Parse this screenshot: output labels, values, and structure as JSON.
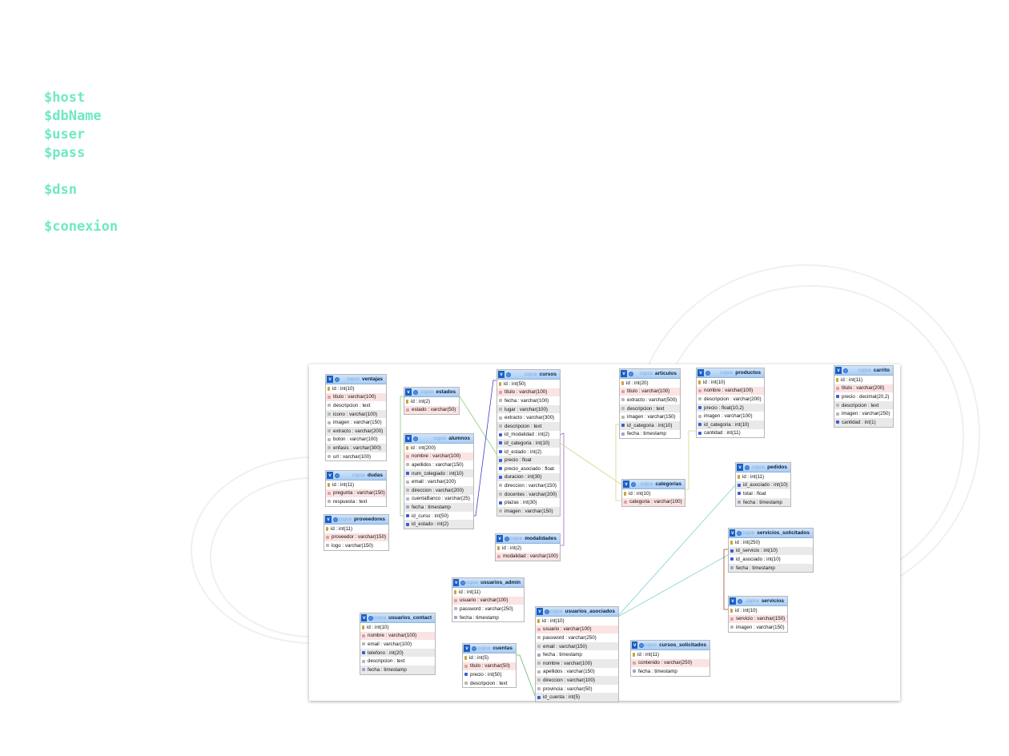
{
  "code_vars": [
    "$host",
    "$dbName",
    "$user",
    "$pass",
    "",
    "$dsn",
    "",
    "$conexion"
  ],
  "diagram": {
    "schema_label": "copce",
    "tables": [
      {
        "id": "ventajas",
        "name": "ventajas",
        "fields": [
          {
            "text": "id : int(10)",
            "icon": "k",
            "tone": "t1"
          },
          {
            "text": "titulo : varchar(100)",
            "icon": "r",
            "tone": "t2"
          },
          {
            "text": "descripcion : text",
            "icon": "s",
            "tone": "t1"
          },
          {
            "text": "icono : varchar(100)",
            "icon": "s",
            "tone": "t3"
          },
          {
            "text": "imagen : varchar(150)",
            "icon": "s",
            "tone": "t1"
          },
          {
            "text": "extracto : varchar(200)",
            "icon": "s",
            "tone": "t3"
          },
          {
            "text": "boton : varchar(100)",
            "icon": "s",
            "tone": "t1"
          },
          {
            "text": "enfasis : varchar(300)",
            "icon": "s",
            "tone": "t3"
          },
          {
            "text": "url : varchar(100)",
            "icon": "s",
            "tone": "t1"
          }
        ]
      },
      {
        "id": "dudas",
        "name": "dudas",
        "fields": [
          {
            "text": "id : int(11)",
            "icon": "k",
            "tone": "t1"
          },
          {
            "text": "pregunta : varchar(150)",
            "icon": "r",
            "tone": "t2"
          },
          {
            "text": "respuesta : text",
            "icon": "s",
            "tone": "t1"
          }
        ]
      },
      {
        "id": "proveedores",
        "name": "proveedores",
        "fields": [
          {
            "text": "id : int(11)",
            "icon": "k",
            "tone": "t1"
          },
          {
            "text": "proveedor : varchar(150)",
            "icon": "r",
            "tone": "t2"
          },
          {
            "text": "logo : varchar(150)",
            "icon": "s",
            "tone": "t1"
          }
        ]
      },
      {
        "id": "estados",
        "name": "estados",
        "fields": [
          {
            "text": "id : int(2)",
            "icon": "k",
            "tone": "t1"
          },
          {
            "text": "estado : varchar(50)",
            "icon": "r",
            "tone": "t2"
          }
        ]
      },
      {
        "id": "alumnos",
        "name": "alumnos",
        "fields": [
          {
            "text": "id : int(200)",
            "icon": "k",
            "tone": "t1"
          },
          {
            "text": "nombre : varchar(100)",
            "icon": "r",
            "tone": "t2"
          },
          {
            "text": "apellidos : varchar(150)",
            "icon": "s",
            "tone": "t1"
          },
          {
            "text": "num_colegiado : int(10)",
            "icon": "b",
            "tone": "t3"
          },
          {
            "text": "email : varchar(100)",
            "icon": "s",
            "tone": "t1"
          },
          {
            "text": "direccion : varchar(200)",
            "icon": "s",
            "tone": "t3"
          },
          {
            "text": "cuentaBanco : varchar(25)",
            "icon": "s",
            "tone": "t1"
          },
          {
            "text": "fecha : timestamp",
            "icon": "d",
            "tone": "t3"
          },
          {
            "text": "id_curso : int(50)",
            "icon": "b",
            "tone": "t1"
          },
          {
            "text": "id_estado : int(2)",
            "icon": "b",
            "tone": "t3"
          }
        ]
      },
      {
        "id": "cursos",
        "name": "cursos",
        "fields": [
          {
            "text": "id : int(50)",
            "icon": "k",
            "tone": "t1"
          },
          {
            "text": "titulo : varchar(100)",
            "icon": "r",
            "tone": "t2"
          },
          {
            "text": "fecha : varchar(100)",
            "icon": "s",
            "tone": "t1"
          },
          {
            "text": "lugar : varchar(100)",
            "icon": "s",
            "tone": "t3"
          },
          {
            "text": "extracto : varchar(300)",
            "icon": "s",
            "tone": "t1"
          },
          {
            "text": "descripcion : text",
            "icon": "s",
            "tone": "t3"
          },
          {
            "text": "id_modalidad : int(2)",
            "icon": "b",
            "tone": "t1"
          },
          {
            "text": "id_categoria : int(10)",
            "icon": "b",
            "tone": "t3"
          },
          {
            "text": "id_estado : int(2)",
            "icon": "b",
            "tone": "t1"
          },
          {
            "text": "precio : float",
            "icon": "b",
            "tone": "t3"
          },
          {
            "text": "precio_asociado : float",
            "icon": "b",
            "tone": "t1"
          },
          {
            "text": "duracion : int(30)",
            "icon": "b",
            "tone": "t3"
          },
          {
            "text": "direccion : varchar(150)",
            "icon": "s",
            "tone": "t1"
          },
          {
            "text": "docentes : varchar(200)",
            "icon": "s",
            "tone": "t3"
          },
          {
            "text": "plazas : int(30)",
            "icon": "b",
            "tone": "t1"
          },
          {
            "text": "imagen : varchar(150)",
            "icon": "s",
            "tone": "t3"
          }
        ]
      },
      {
        "id": "modalidades",
        "name": "modalidades",
        "fields": [
          {
            "text": "id : int(2)",
            "icon": "k",
            "tone": "t1"
          },
          {
            "text": "modalidad : varchar(100)",
            "icon": "r",
            "tone": "t2"
          }
        ]
      },
      {
        "id": "articulos",
        "name": "articulos",
        "fields": [
          {
            "text": "id : int(20)",
            "icon": "k",
            "tone": "t1"
          },
          {
            "text": "titulo : varchar(100)",
            "icon": "r",
            "tone": "t2"
          },
          {
            "text": "extracto : varchar(500)",
            "icon": "s",
            "tone": "t1"
          },
          {
            "text": "descripcion : text",
            "icon": "s",
            "tone": "t3"
          },
          {
            "text": "imagen : varchar(150)",
            "icon": "s",
            "tone": "t1"
          },
          {
            "text": "id_categoria : int(10)",
            "icon": "b",
            "tone": "t3"
          },
          {
            "text": "fecha : timestamp",
            "icon": "d",
            "tone": "t1"
          }
        ]
      },
      {
        "id": "productos",
        "name": "productos",
        "fields": [
          {
            "text": "id : int(10)",
            "icon": "k",
            "tone": "t1"
          },
          {
            "text": "nombre : varchar(100)",
            "icon": "r",
            "tone": "t2"
          },
          {
            "text": "descripcion : varchar(200)",
            "icon": "s",
            "tone": "t1"
          },
          {
            "text": "precio : float(10,2)",
            "icon": "b",
            "tone": "t3"
          },
          {
            "text": "imagen : varchar(100)",
            "icon": "s",
            "tone": "t1"
          },
          {
            "text": "id_categoria : int(10)",
            "icon": "b",
            "tone": "t3"
          },
          {
            "text": "cantidad : int(11)",
            "icon": "b",
            "tone": "t1"
          }
        ]
      },
      {
        "id": "carrito",
        "name": "carrito",
        "fields": [
          {
            "text": "id : int(11)",
            "icon": "k",
            "tone": "t1"
          },
          {
            "text": "titulo : varchar(200)",
            "icon": "r",
            "tone": "t2"
          },
          {
            "text": "precio : decimal(20,2)",
            "icon": "b",
            "tone": "t1"
          },
          {
            "text": "descripcion : text",
            "icon": "s",
            "tone": "t3"
          },
          {
            "text": "imagen : varchar(250)",
            "icon": "s",
            "tone": "t1"
          },
          {
            "text": "cantidad : int(1)",
            "icon": "b",
            "tone": "t3"
          }
        ]
      },
      {
        "id": "categorias",
        "name": "categorias",
        "fields": [
          {
            "text": "id : int(10)",
            "icon": "k",
            "tone": "t1"
          },
          {
            "text": "categoria : varchar(100)",
            "icon": "r",
            "tone": "t2"
          }
        ]
      },
      {
        "id": "pedidos",
        "name": "pedidos",
        "fields": [
          {
            "text": "id : int(11)",
            "icon": "k",
            "tone": "t1"
          },
          {
            "text": "id_asociado : int(10)",
            "icon": "b",
            "tone": "t3"
          },
          {
            "text": "total : float",
            "icon": "b",
            "tone": "t1"
          },
          {
            "text": "fecha : timestamp",
            "icon": "d",
            "tone": "t3"
          }
        ]
      },
      {
        "id": "servicios_solicitados",
        "name": "servicios_solicitados",
        "fields": [
          {
            "text": "id : int(250)",
            "icon": "k",
            "tone": "t1"
          },
          {
            "text": "id_servicio : int(10)",
            "icon": "b",
            "tone": "t3"
          },
          {
            "text": "id_asociado : int(10)",
            "icon": "b",
            "tone": "t1"
          },
          {
            "text": "fecha : timestamp",
            "icon": "d",
            "tone": "t3"
          }
        ]
      },
      {
        "id": "servicios",
        "name": "servicios",
        "fields": [
          {
            "text": "id : int(10)",
            "icon": "k",
            "tone": "t1"
          },
          {
            "text": "servicio : varchar(150)",
            "icon": "r",
            "tone": "t2"
          },
          {
            "text": "imagen : varchar(150)",
            "icon": "s",
            "tone": "t1"
          }
        ]
      },
      {
        "id": "usuarios_admin",
        "name": "usuarios_admin",
        "fields": [
          {
            "text": "id : int(11)",
            "icon": "k",
            "tone": "t1"
          },
          {
            "text": "usuario : varchar(100)",
            "icon": "r",
            "tone": "t2"
          },
          {
            "text": "password : varchar(250)",
            "icon": "s",
            "tone": "t1"
          },
          {
            "text": "fecha : timestamp",
            "icon": "d",
            "tone": "t1"
          }
        ]
      },
      {
        "id": "usuarios_contact",
        "name": "usuarios_contact",
        "fields": [
          {
            "text": "id : int(10)",
            "icon": "k",
            "tone": "t1"
          },
          {
            "text": "nombre : varchar(100)",
            "icon": "r",
            "tone": "t2"
          },
          {
            "text": "email : varchar(100)",
            "icon": "s",
            "tone": "t1"
          },
          {
            "text": "telefono : int(20)",
            "icon": "b",
            "tone": "t3"
          },
          {
            "text": "descripcion : text",
            "icon": "s",
            "tone": "t1"
          },
          {
            "text": "fecha : timestamp",
            "icon": "d",
            "tone": "t3"
          }
        ]
      },
      {
        "id": "usuarios_asociados",
        "name": "usuarios_asociados",
        "fields": [
          {
            "text": "id : int(10)",
            "icon": "k",
            "tone": "t1"
          },
          {
            "text": "usuario : varchar(100)",
            "icon": "r",
            "tone": "t2"
          },
          {
            "text": "password : varchar(250)",
            "icon": "s",
            "tone": "t1"
          },
          {
            "text": "email : varchar(150)",
            "icon": "s",
            "tone": "t3"
          },
          {
            "text": "fecha : timestamp",
            "icon": "d",
            "tone": "t1"
          },
          {
            "text": "nombre : varchar(100)",
            "icon": "s",
            "tone": "t3"
          },
          {
            "text": "apellidos : varchar(150)",
            "icon": "s",
            "tone": "t1"
          },
          {
            "text": "direccion : varchar(100)",
            "icon": "s",
            "tone": "t3"
          },
          {
            "text": "provincia : varchar(50)",
            "icon": "s",
            "tone": "t1"
          },
          {
            "text": "id_cuenta : int(5)",
            "icon": "b",
            "tone": "t3"
          }
        ]
      },
      {
        "id": "cuentas",
        "name": "cuentas",
        "fields": [
          {
            "text": "id : int(5)",
            "icon": "k",
            "tone": "t1"
          },
          {
            "text": "titulo : varchar(50)",
            "icon": "r",
            "tone": "t2"
          },
          {
            "text": "precio : int(50)",
            "icon": "b",
            "tone": "t1"
          },
          {
            "text": "descripcion : text",
            "icon": "s",
            "tone": "t1"
          }
        ]
      },
      {
        "id": "cursos_solicitados",
        "name": "cursos_solicitados",
        "fields": [
          {
            "text": "id : int(11)",
            "icon": "k",
            "tone": "t1"
          },
          {
            "text": "contenido : varchar(250)",
            "icon": "r",
            "tone": "t2"
          },
          {
            "text": "fecha : timestamp",
            "icon": "d",
            "tone": "t1"
          }
        ]
      }
    ]
  }
}
